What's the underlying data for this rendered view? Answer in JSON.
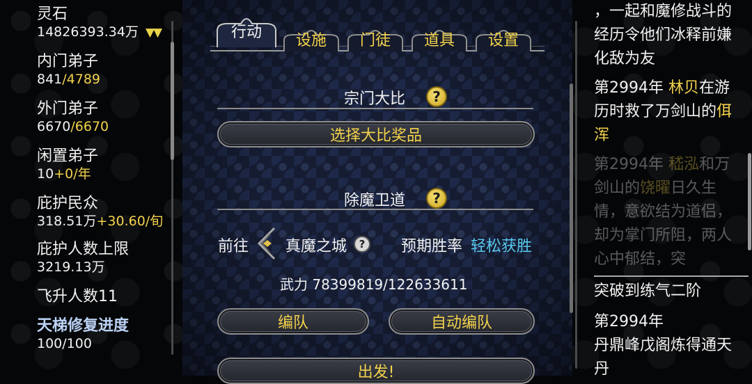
{
  "left": {
    "spirit_stone_label": "灵石",
    "spirit_stone_value": "14826393.34万",
    "spirit_stone_indicator": "▼▼",
    "inner_disciples_label": "内门弟子",
    "inner_disciples_current": "841",
    "inner_disciples_max": "/4789",
    "outer_disciples_label": "外门弟子",
    "outer_disciples_current": "6670",
    "outer_disciples_max": "/6670",
    "idle_disciples_label": "闲置弟子",
    "idle_disciples_current": "10",
    "idle_disciples_rate": "+0/年",
    "protected_label": "庇护民众",
    "protected_value": "318.51万",
    "protected_rate": "+30.60/旬",
    "protected_cap_label": "庇护人数上限",
    "protected_cap_value": "3219.13万",
    "ascended_label": "飞升人数11",
    "ladder_label": "天梯修复进度",
    "ladder_value": "100/100"
  },
  "tabs": [
    {
      "label": "行动",
      "active": true
    },
    {
      "label": "设施",
      "active": false
    },
    {
      "label": "门徒",
      "active": false
    },
    {
      "label": "道具",
      "active": false
    },
    {
      "label": "设置",
      "active": false
    }
  ],
  "tournament": {
    "title": "宗门大比",
    "help_icon": "?",
    "select_prize_label": "选择大比奖品"
  },
  "demon": {
    "title": "除魔卫道",
    "help_icon": "?",
    "goto_label": "前往",
    "target_city": "真魔之城",
    "target_help_icon": "?",
    "win_rate_label": "预期胜率",
    "win_rate_value": "轻松获胜",
    "force_text": "武力 78399819/122633611",
    "formation_label": "编队",
    "auto_formation_label": "自动编队",
    "depart_label": "出发!"
  },
  "log": {
    "entry1": "，一起和魔修战斗的经历令他们冰释前嫌化敌为友",
    "entry2_year": "第2994年",
    "entry2_name": "林贝",
    "entry2_text1": "在游历时救了万剑山的",
    "entry2_name2": "佴浑",
    "entry3_year": "第2994年",
    "entry3_name": "嵇泓",
    "entry3_text1": "和万剑山的",
    "entry3_name2": "饶曜",
    "entry3_text2": "日久生情，意欲结为道侣，却为掌门所阻，两人心中郁结，突",
    "entry4": "突破到练气二阶",
    "entry5_year": "第2994年",
    "entry5_text": "丹鼎峰戊阁炼得通天丹"
  },
  "colors": {
    "accent_yellow": "#f2d24c",
    "cyan": "#58c9ef",
    "panel_bg": "#161d33"
  }
}
